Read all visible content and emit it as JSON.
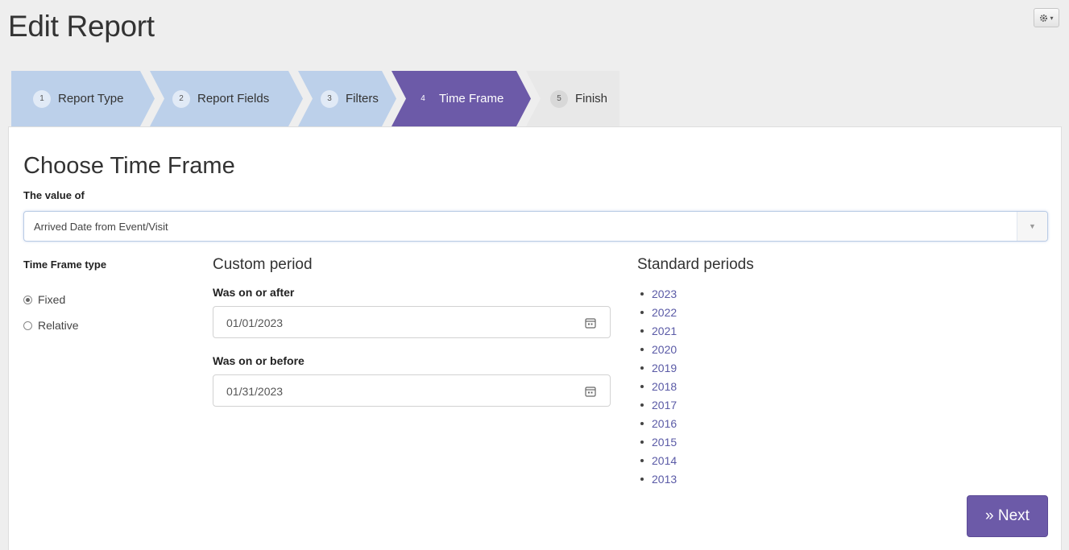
{
  "page": {
    "title": "Edit Report"
  },
  "settings": {
    "icon": "gear-icon"
  },
  "wizard": {
    "steps": [
      {
        "num": "1",
        "label": "Report Type"
      },
      {
        "num": "2",
        "label": "Report Fields"
      },
      {
        "num": "3",
        "label": "Filters"
      },
      {
        "num": "4",
        "label": "Time Frame",
        "active": true
      },
      {
        "num": "5",
        "label": "Finish"
      }
    ]
  },
  "form": {
    "section_title": "Choose Time Frame",
    "value_of_label": "The value of",
    "value_of_selected": "Arrived Date from Event/Visit",
    "time_frame_type_label": "Time Frame type",
    "time_frame_options": [
      {
        "label": "Fixed",
        "checked": true
      },
      {
        "label": "Relative",
        "checked": false
      }
    ],
    "custom_period": {
      "title": "Custom period",
      "after_label": "Was on or after",
      "after_value": "01/01/2023",
      "before_label": "Was on or before",
      "before_value": "01/31/2023"
    },
    "standard_periods": {
      "title": "Standard periods",
      "items": [
        "2023",
        "2022",
        "2021",
        "2020",
        "2019",
        "2018",
        "2017",
        "2016",
        "2015",
        "2014",
        "2013"
      ]
    },
    "next_label": "» Next"
  },
  "colors": {
    "accent": "#6c5aa8",
    "step_done": "#bcd0ea",
    "step_pending": "#e8e8e8",
    "link": "#5a5aa6"
  }
}
